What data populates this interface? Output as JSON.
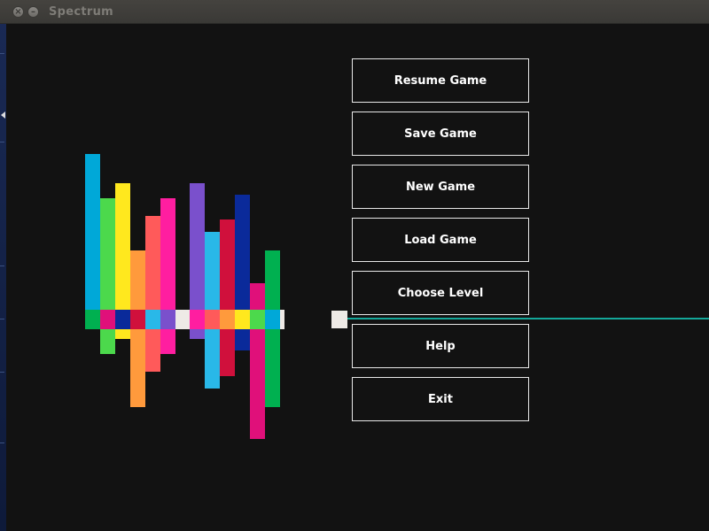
{
  "window": {
    "title": "Spectrum",
    "buttons": {
      "close": "×",
      "minimize": "–"
    }
  },
  "menu": {
    "items": [
      {
        "label": "Resume Game",
        "name": "resume-game-button"
      },
      {
        "label": "Save Game",
        "name": "save-game-button"
      },
      {
        "label": "New Game",
        "name": "new-game-button"
      },
      {
        "label": "Load Game",
        "name": "load-game-button"
      },
      {
        "label": "Choose Level",
        "name": "choose-level-button"
      },
      {
        "label": "Help",
        "name": "help-button"
      },
      {
        "label": "Exit",
        "name": "exit-button"
      }
    ]
  },
  "colors": {
    "background": "#121212",
    "beam": "#14a89a",
    "player": "#eeeae6",
    "spectrum": [
      "#00a8d8",
      "#4cd94c",
      "#ffe81e",
      "#ff9a3c",
      "#ff5a5a",
      "#ff1ea0",
      "#7a50cc",
      "#29b8e8",
      "#d0103c",
      "#0a2a9a",
      "#e0107a",
      "#00b050"
    ]
  }
}
